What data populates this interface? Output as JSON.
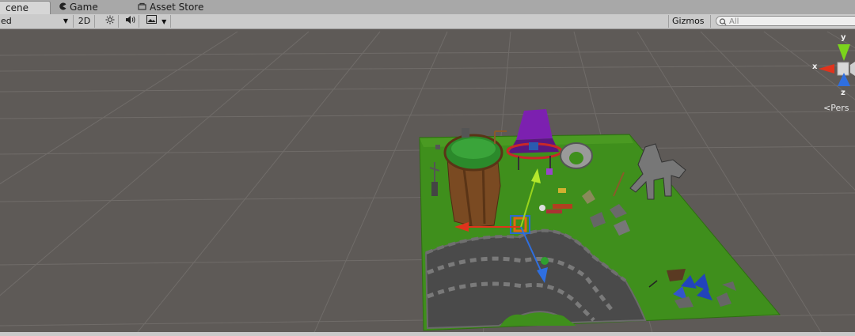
{
  "tabs": [
    {
      "label": "cene",
      "icon": "scene-icon",
      "active": true
    },
    {
      "label": "Game",
      "icon": "game-pacman-icon"
    },
    {
      "label": "Asset Store",
      "icon": "asset-store-icon"
    }
  ],
  "toolbar": {
    "shading_mode": "ed",
    "toggle_2d_label": "2D",
    "lighting_icon": "sun-icon",
    "audio_icon": "speaker-icon",
    "effects_icon": "image-icon",
    "gizmos_label": "Gizmos",
    "search_placeholder": "All"
  },
  "orientation_gizmo": {
    "axes": [
      "y",
      "x",
      "z"
    ],
    "projection_label": "Pers",
    "colors": {
      "x": "#e0331c",
      "y": "#7bd41c",
      "z": "#2f6fe0"
    }
  },
  "colors": {
    "viewport_bg": "#5e5a57",
    "grid": "#6f6b68",
    "ground": "#3f8f1c",
    "road": "#4a4a4a"
  }
}
